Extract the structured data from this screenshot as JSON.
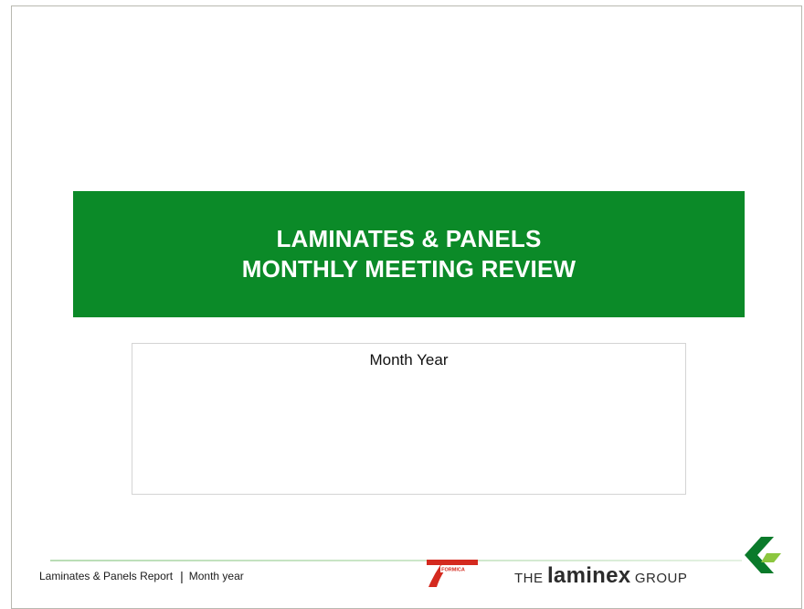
{
  "slide": {
    "title_line_1": "LAMINATES & PANELS",
    "title_line_2": "MONTHLY MEETING REVIEW",
    "subtitle": "Month Year"
  },
  "footer": {
    "report_name": "Laminates & Panels Report",
    "separator": "|",
    "date": "Month year",
    "formica_logo_text": "FORMICA",
    "laminex_the": "THE",
    "laminex_name": "laminex",
    "laminex_group": "GROUP"
  },
  "colors": {
    "title_band": "#0b8a28",
    "title_text": "#ffffff",
    "formica_red": "#d42a1f",
    "chevron_dark": "#0a7a2a",
    "chevron_light": "#8cc63f"
  },
  "icons": {
    "formica": "formica-logo-icon",
    "chevron": "laminex-chevron-icon"
  }
}
